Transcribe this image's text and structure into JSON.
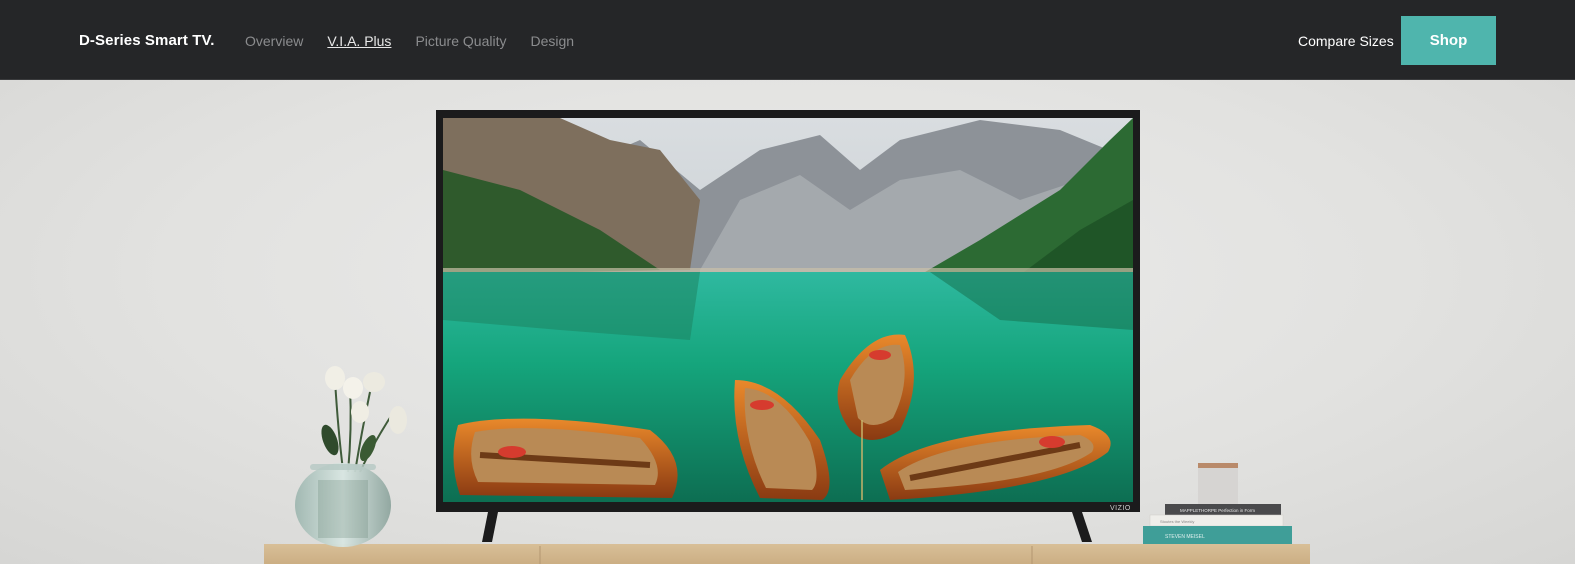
{
  "header": {
    "brand": "D-Series Smart TV.",
    "nav": [
      {
        "label": "Overview",
        "active": false
      },
      {
        "label": "V.I.A. Plus",
        "active": true
      },
      {
        "label": "Picture Quality",
        "active": false
      },
      {
        "label": "Design",
        "active": false
      }
    ],
    "compare_label": "Compare Sizes",
    "shop_label": "Shop"
  },
  "hero": {
    "tv_logo": "VIZIO",
    "books": [
      "MAPPLETHORPE Perfection in Form",
      "Stoutes the Weekly",
      "STEVEN MEISEL"
    ]
  },
  "colors": {
    "header_bg": "#252628",
    "accent": "#4fb5ad",
    "nav_inactive": "#8b8c8e",
    "nav_active": "#e8e8e8"
  }
}
